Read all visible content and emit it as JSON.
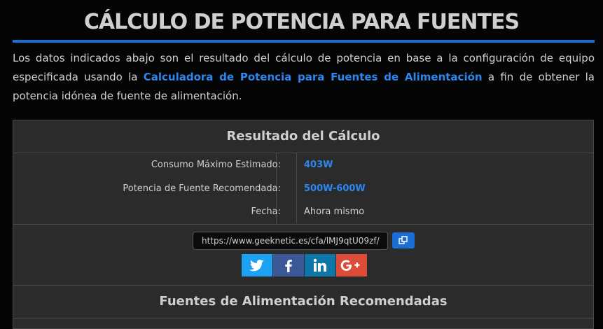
{
  "page": {
    "title": "CÁLCULO DE POTENCIA PARA FUENTES",
    "intro_before": "Los datos indicados abajo son el resultado del cálculo de potencia en base a la configuración de equipo especificada usando la ",
    "intro_link": "Calculadora de Potencia para Fuentes de Alimentación",
    "intro_after": " a fin de obtener la potencia idónea de fuente de alimentación.",
    "accent_color": "#1a6fd6"
  },
  "result": {
    "heading": "Resultado del Cálculo",
    "rows": [
      {
        "label": "Consumo Máximo Estimado:",
        "value": "403W"
      },
      {
        "label": "Potencia de Fuente Recomendada:",
        "value": "500W-600W"
      },
      {
        "label": "Fecha:",
        "value": "Ahora mismo"
      }
    ],
    "share_url": "https://www.geeknetic.es/cfa/lMJ9qtU09zf/",
    "copy_icon": "copy-icon",
    "social": [
      "twitter-icon",
      "facebook-icon",
      "linkedin-icon",
      "google-plus-icon"
    ]
  },
  "recommended": {
    "heading": "Fuentes de Alimentación Recomendadas"
  }
}
